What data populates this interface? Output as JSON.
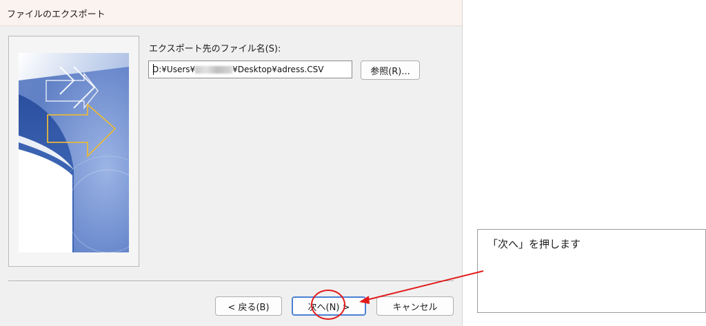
{
  "window": {
    "title": "ファイルのエクスポート"
  },
  "form": {
    "filename_label": "エクスポート先のファイル名(S):",
    "path_value": "D:¥Users¥",
    "path_value_tail": "¥Desktop¥adress.CSV",
    "browse_label": "参照(R)..."
  },
  "buttons": {
    "back_label": "< 戻る(B)",
    "next_label": "次へ(N) >",
    "cancel_label": "キャンセル"
  },
  "annotation": {
    "callout_text": "「次へ」を押します",
    "highlight_color": "#e21a1a"
  },
  "icons": {
    "wizard_art": "export-wizard-illustration"
  }
}
